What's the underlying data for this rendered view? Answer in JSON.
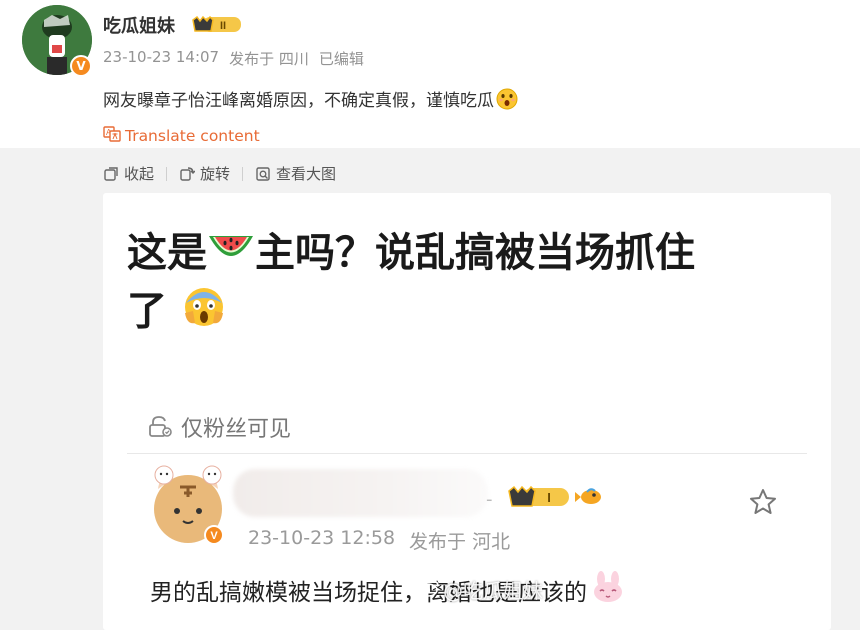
{
  "post": {
    "author": "吃瓜姐妹",
    "level_badge": "II",
    "verified_badge": "V",
    "timestamp": "23-10-23 14:07",
    "location": "发布于 四川",
    "edited": "已编辑",
    "text": "网友曝章子怡汪峰离婚原因，不确定真假，谨慎吃瓜",
    "translate_label": "Translate content"
  },
  "toolbar": {
    "collapse_label": "收起",
    "rotate_label": "旋转",
    "view_large_label": "查看大图"
  },
  "image_card": {
    "title_part1": "这是",
    "title_part2": "主吗？说乱搞被当场抓住",
    "title_part3": "了",
    "fans_only_label": "仅粉丝可见",
    "comment": {
      "name_tail": "-",
      "level_badge": "I",
      "verified_badge": "V",
      "timestamp": "23-10-23 12:58",
      "location": "发布于 河北",
      "text": "男的乱搞嫩模被当场捉住，离婚也是应该的"
    },
    "watermark": "@吃瓜姐妹"
  },
  "colors": {
    "accent_orange": "#e86b36",
    "badge_gold": "#f5b820",
    "verified_orange": "#f58a1f"
  },
  "icons": {
    "translate": "translate-icon",
    "collapse": "collapse-icon",
    "rotate": "rotate-icon",
    "view_large": "zoom-icon",
    "star": "star-icon"
  }
}
